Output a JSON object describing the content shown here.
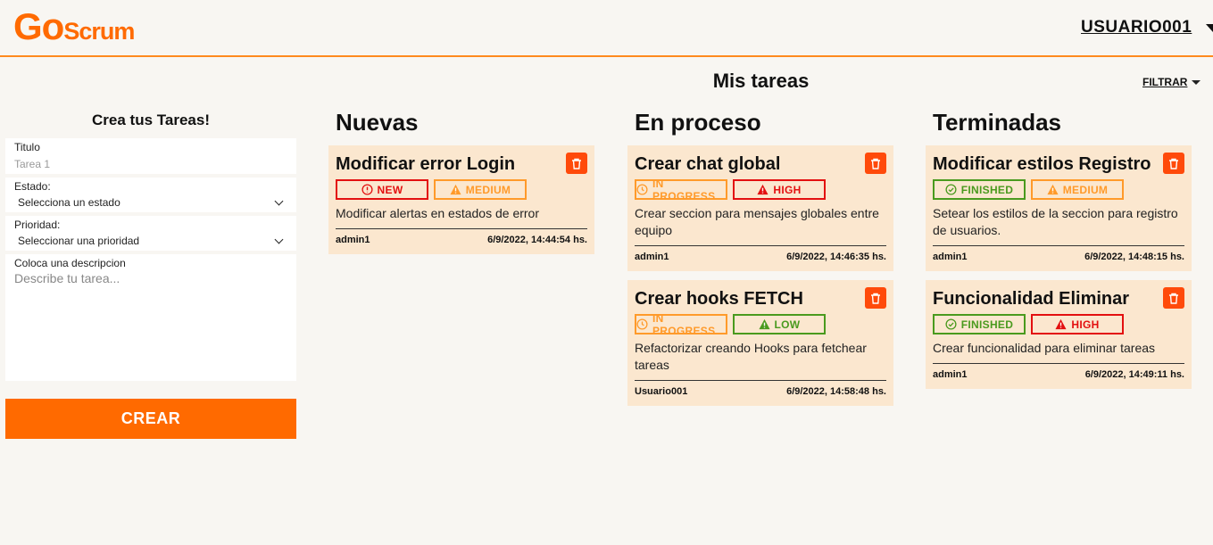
{
  "header": {
    "logo_go": "Go",
    "logo_scrum": "Scrum",
    "username": "USUARIO001"
  },
  "main": {
    "title": "Mis tareas",
    "filter_label": "FILTRAR"
  },
  "form": {
    "title": "Crea tus Tareas!",
    "titulo_label": "Titulo",
    "titulo_placeholder": "Tarea 1",
    "estado_label": "Estado:",
    "estado_value": "Selecciona un estado",
    "prioridad_label": "Prioridad:",
    "prioridad_value": "Seleccionar una prioridad",
    "descripcion_label": "Coloca una descripcion",
    "descripcion_placeholder": "Describe tu tarea...",
    "submit_label": "CREAR"
  },
  "columns": [
    {
      "title": "Nuevas",
      "cards": [
        {
          "title": "Modificar error Login",
          "status": "NEW",
          "priority": "MEDIUM",
          "description": "Modificar alertas en estados de error",
          "author": "admin1",
          "date": "6/9/2022, 14:44:54 hs."
        }
      ]
    },
    {
      "title": "En proceso",
      "cards": [
        {
          "title": "Crear chat global",
          "status": "IN PROGRESS",
          "priority": "HIGH",
          "description": "Crear seccion para mensajes globales entre equipo",
          "author": "admin1",
          "date": "6/9/2022, 14:46:35 hs."
        },
        {
          "title": "Crear hooks FETCH",
          "status": "IN PROGRESS",
          "priority": "LOW",
          "description": "Refactorizar creando Hooks para fetchear tareas",
          "author": "Usuario001",
          "date": "6/9/2022, 14:58:48 hs."
        }
      ]
    },
    {
      "title": "Terminadas",
      "cards": [
        {
          "title": "Modificar estilos Registro",
          "status": "FINISHED",
          "priority": "MEDIUM",
          "description": "Setear los estilos de la seccion para registro de usuarios.",
          "author": "admin1",
          "date": "6/9/2022, 14:48:15 hs."
        },
        {
          "title": "Funcionalidad Eliminar",
          "status": "FINISHED",
          "priority": "HIGH",
          "description": "Crear funcionalidad para eliminar tareas",
          "author": "admin1",
          "date": "6/9/2022, 14:49:11 hs."
        }
      ]
    }
  ],
  "colors": {
    "brand": "#ff6a00",
    "card_bg": "#fbe7cf",
    "delete": "#ff4a0a",
    "status_new": "#e31010",
    "status_in_progress": "#ff9a2a",
    "status_finished": "#4a9a1e",
    "priority_high": "#e31010",
    "priority_medium": "#ff9a2a",
    "priority_low": "#4a9a1e"
  }
}
